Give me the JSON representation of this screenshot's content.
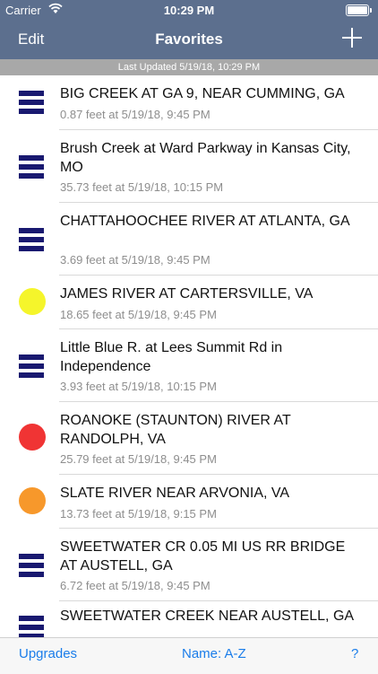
{
  "status_bar": {
    "carrier": "Carrier",
    "time": "10:29 PM"
  },
  "nav": {
    "edit": "Edit",
    "title": "Favorites",
    "add_icon": "plus-icon"
  },
  "last_updated": "Last Updated 5/19/18, 10:29 PM",
  "colors": {
    "nav_bg": "#5c6f8e",
    "flat_icon": "#191970",
    "yellow": "#f5f52b",
    "red": "#f03434",
    "orange": "#f7982b",
    "tab_tint": "#1a7dea"
  },
  "rows": [
    {
      "name": "BIG CREEK AT GA 9, NEAR CUMMING, GA",
      "detail": "0.87 feet at 5/19/18, 9:45 PM",
      "icon": "flat-trend-icon"
    },
    {
      "name": "Brush Creek at Ward Parkway in Kansas City, MO",
      "detail": "35.73 feet at 5/19/18, 10:15 PM",
      "icon": "flat-trend-icon"
    },
    {
      "name": "CHATTAHOOCHEE RIVER AT ATLANTA, GA",
      "detail": "3.69 feet at 5/19/18, 9:45 PM",
      "icon": "flat-trend-icon"
    },
    {
      "name": "JAMES RIVER AT CARTERSVILLE, VA",
      "detail": "18.65 feet at 5/19/18, 9:45 PM",
      "icon": "yellow-circle-icon"
    },
    {
      "name": "Little Blue R. at Lees Summit Rd in Independence",
      "detail": "3.93 feet at 5/19/18, 10:15 PM",
      "icon": "flat-trend-icon"
    },
    {
      "name": "ROANOKE (STAUNTON) RIVER AT RANDOLPH, VA",
      "detail": "25.79 feet at 5/19/18, 9:45 PM",
      "icon": "red-circle-icon"
    },
    {
      "name": "SLATE RIVER NEAR ARVONIA, VA",
      "detail": "13.73 feet at 5/19/18, 9:15 PM",
      "icon": "orange-circle-icon"
    },
    {
      "name": "SWEETWATER CR 0.05 MI US RR BRIDGE AT AUSTELL, GA",
      "detail": "6.72 feet at 5/19/18, 9:45 PM",
      "icon": "flat-trend-icon"
    },
    {
      "name": "SWEETWATER CREEK NEAR AUSTELL, GA",
      "detail": "",
      "icon": "flat-trend-icon"
    }
  ],
  "tab_bar": {
    "upgrades": "Upgrades",
    "sort": "Name: A-Z",
    "help": "?"
  }
}
